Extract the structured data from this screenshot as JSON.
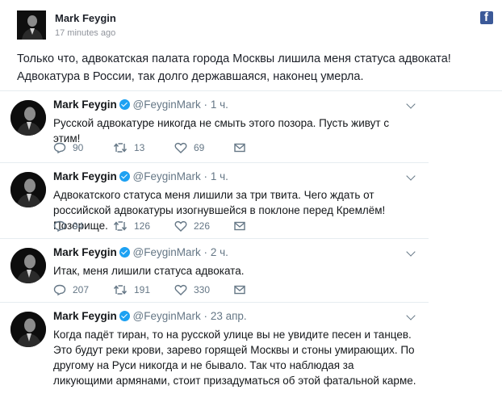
{
  "post": {
    "author": "Mark Feygin",
    "time": "17 minutes ago",
    "text": "Только что, адвокатская палата города Москвы лишила меня статуса адвоката! Адвокатура в России, так долго державшаяся, наконец умерла.",
    "logo_icon": "facebook-icon",
    "logo_color": "#3b5998"
  },
  "tweets": [
    {
      "name": "Mark Feygin",
      "handle": "@FeyginMark",
      "dot": "·",
      "time": "1 ч.",
      "text": "Русской адвокатуре никогда не смыть этого позора. Пусть живут с этим!",
      "replies": "90",
      "retweets": "13",
      "likes": "69"
    },
    {
      "name": "Mark Feygin",
      "handle": "@FeyginMark",
      "dot": "·",
      "time": "1 ч.",
      "text": "Адвокатского статуса меня лишили за три твита. Чего ждать от российской адвокатуры изогнувшейся в поклоне перед Кремлём! Позорище.",
      "replies": "94",
      "retweets": "126",
      "likes": "226"
    },
    {
      "name": "Mark Feygin",
      "handle": "@FeyginMark",
      "dot": "·",
      "time": "2 ч.",
      "text": "Итак, меня лишили статуса адвоката.",
      "replies": "207",
      "retweets": "191",
      "likes": "330"
    },
    {
      "name": "Mark Feygin",
      "handle": "@FeyginMark",
      "dot": "·",
      "time": "23 апр.",
      "text": "Когда падёт тиран, то на русской улице вы не увидите песен и танцев. Это будут реки крови, зарево горящей Москвы и стоны умирающих. По другому на Руси никогда и не бывало. Так что наблюдая за ликующими армянами, стоит призадуматься об этой фатальной карме."
    }
  ],
  "colors": {
    "verified": "#1da1f2",
    "secondary_text": "#657786"
  }
}
